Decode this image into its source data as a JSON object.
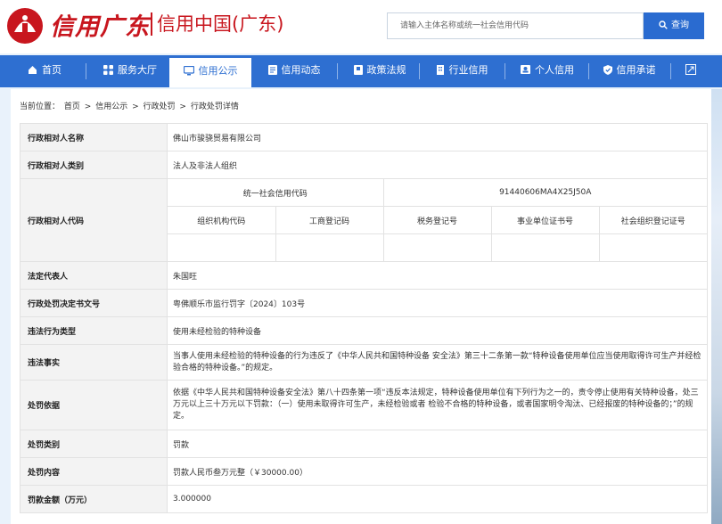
{
  "header": {
    "brand_cn": "信用广东",
    "brand_sub": "信用中国(广东)",
    "search_placeholder": "请输入主体名称或统一社会信用代码",
    "search_button": "查询"
  },
  "nav": {
    "items": [
      {
        "label": "首页",
        "icon": "home-icon"
      },
      {
        "label": "服务大厅",
        "icon": "grid-icon"
      },
      {
        "label": "信用公示",
        "icon": "monitor-icon"
      },
      {
        "label": "信用动态",
        "icon": "document-icon"
      },
      {
        "label": "政策法规",
        "icon": "book-icon"
      },
      {
        "label": "行业信用",
        "icon": "building-icon"
      },
      {
        "label": "个人信用",
        "icon": "id-card-icon"
      },
      {
        "label": "信用承诺",
        "icon": "shield-icon"
      }
    ],
    "active_index": 2
  },
  "breadcrumb": {
    "prefix": "当前位置：",
    "items": [
      "首页",
      "信用公示",
      "行政处罚",
      "行政处罚详情"
    ],
    "sep": ">"
  },
  "detail": {
    "name_label": "行政相对人名称",
    "name_value": "佛山市骏骁贸易有限公司",
    "type_label": "行政相对人类别",
    "type_value": "法人及非法人组织",
    "code_label": "行政相对人代码",
    "code_usci_label": "统一社会信用代码",
    "code_usci_value": "91440606MA4X25J50A",
    "code_headers": [
      "组织机构代码",
      "工商登记码",
      "税务登记号",
      "事业单位证书号",
      "社会组织登记证号"
    ],
    "code_values": [
      "",
      "",
      "",
      "",
      ""
    ],
    "legal_rep_label": "法定代表人",
    "legal_rep_value": "朱国旺",
    "doc_no_label": "行政处罚决定书文号",
    "doc_no_value": "粤佛顺乐市监行罚字〔2024〕103号",
    "violation_type_label": "违法行为类型",
    "violation_type_value": "使用未经检验的特种设备",
    "facts_label": "违法事实",
    "facts_value": "当事人使用未经检验的特种设备的行为违反了《中华人民共和国特种设备 安全法》第三十二条第一款“特种设备使用单位应当使用取得许可生产并经检验合格的特种设备。”的规定。",
    "basis_label": "处罚依据",
    "basis_value": "依据《中华人民共和国特种设备安全法》第八十四条第一项“违反本法规定，特种设备使用单位有下列行为之一的，责令停止使用有关特种设备，处三万元以上三十万元以下罚款：（一）使用未取得许可生产，未经检验或者 检验不合格的特种设备，或者国家明令淘汰、已经报废的特种设备的；”的规定。",
    "category_label": "处罚类别",
    "category_value": "罚款",
    "content_label": "处罚内容",
    "content_value": "罚款人民币叁万元整（￥30000.00）",
    "amount_label": "罚款金额（万元）",
    "amount_value": "3.000000"
  },
  "colors": {
    "brand_red": "#c8161e",
    "nav_blue": "#2e6fd1",
    "search_blue": "#2a6bd0"
  }
}
